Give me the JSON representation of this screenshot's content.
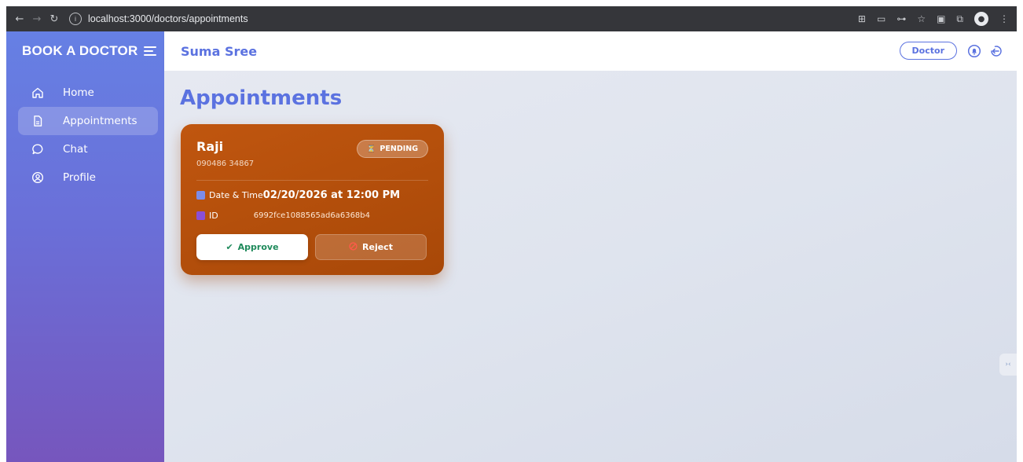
{
  "browser": {
    "url": "localhost:3000/doctors/appointments",
    "icons": [
      "back-icon",
      "forward-icon",
      "reload-icon",
      "info-icon",
      "translate-icon",
      "cast-icon",
      "password-key-icon",
      "star-icon",
      "extension-icon",
      "puzzle-icon",
      "profile-icon",
      "menu-icon"
    ]
  },
  "sidebar": {
    "brand": "BOOK A DOCTOR",
    "items": [
      {
        "label": "Home",
        "icon": "home-icon"
      },
      {
        "label": "Appointments",
        "icon": "document-icon",
        "active": true
      },
      {
        "label": "Chat",
        "icon": "chat-icon"
      },
      {
        "label": "Profile",
        "icon": "user-circle-icon"
      }
    ]
  },
  "header": {
    "user_name": "Suma Sree",
    "role": "Doctor"
  },
  "main": {
    "title": "Appointments",
    "appointment": {
      "patient": "Raji",
      "phone": "090486 34867",
      "status": "PENDING",
      "datetime_label": "Date & Time",
      "datetime_value": "02/20/2026 at 12:00 PM",
      "id_label": "ID",
      "id_value": "6992fce1088565ad6a6368b4",
      "approve_label": "Approve",
      "reject_label": "Reject"
    }
  },
  "colors": {
    "accent": "#5b72e0",
    "card": "#b34f0c",
    "approve_text": "#1f8a5b",
    "reject_icon": "#e53935"
  }
}
